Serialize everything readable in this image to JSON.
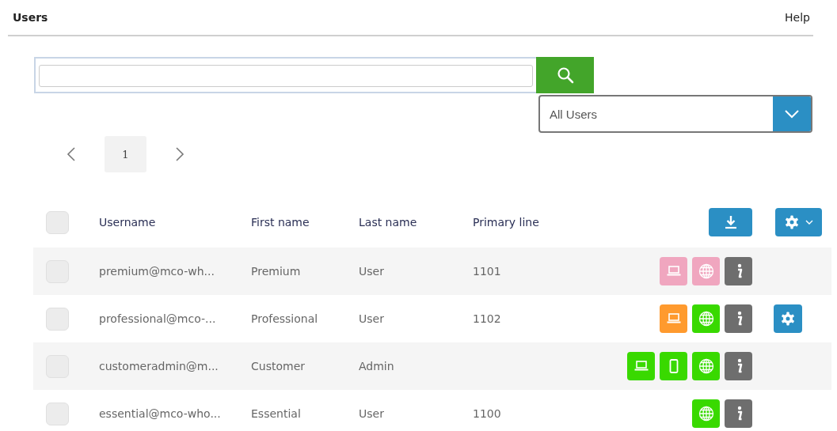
{
  "header": {
    "title": "Users",
    "help": "Help"
  },
  "filter": {
    "value": "All Users"
  },
  "pagination": {
    "pages": [
      {
        "label": "1",
        "selected": true
      }
    ]
  },
  "table": {
    "columns": [
      "Username",
      "First name",
      "Last name",
      "Primary line"
    ],
    "header_checkbox": {
      "checked": false
    },
    "rows": [
      {
        "checked": false,
        "username": "premium@mco-wh...",
        "first_name": "Premium",
        "last_name": "User",
        "primary_line": "1101",
        "devices": [
          {
            "kind": "laptop",
            "color": "#f0a6bf"
          },
          {
            "kind": "web",
            "color": "#f0a6bf"
          }
        ],
        "settings": false
      },
      {
        "checked": false,
        "username": "professional@mco-...",
        "first_name": "Professional",
        "last_name": "User",
        "primary_line": "1102",
        "devices": [
          {
            "kind": "laptop",
            "color": "#ff9a2e"
          },
          {
            "kind": "web",
            "color": "#39d900"
          }
        ],
        "settings": true
      },
      {
        "checked": false,
        "username": "customeradmin@m...",
        "first_name": "Customer",
        "last_name": "Admin",
        "devices": [
          {
            "kind": "laptop",
            "color": "#39d900"
          },
          {
            "kind": "phone",
            "color": "#39d900"
          },
          {
            "kind": "web",
            "color": "#39d900"
          }
        ],
        "settings": false
      },
      {
        "checked": false,
        "username": "essential@mco-who...",
        "first_name": "Essential",
        "last_name": "User",
        "primary_line": "1100",
        "devices": [
          {
            "kind": "web",
            "color": "#39d900"
          }
        ],
        "settings": false
      }
    ]
  }
}
